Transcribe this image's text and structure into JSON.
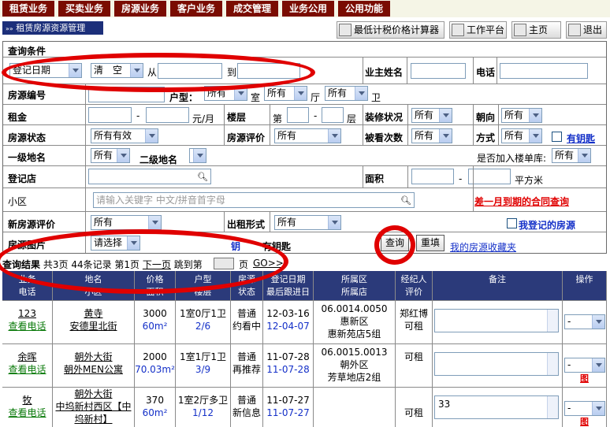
{
  "top_tabs": [
    "租赁业务",
    "买卖业务",
    "房源业务",
    "客户业务",
    "成交管理",
    "业务公用",
    "公用功能"
  ],
  "page_title": "租赁房源资源管理",
  "toolbar": {
    "tax_calc": "最低计税价格计算器",
    "workbench": "工作平台",
    "home": "主页",
    "logout": "退出"
  },
  "form": {
    "section_title": "查询条件",
    "date_type": "登记日期",
    "date_clear": "清　空",
    "from": "从",
    "to": "到",
    "owner_label": "业主姓名",
    "phone_label": "电话",
    "house_no_label": "房源编号",
    "layout_label": "户型：",
    "room_sel": "所有",
    "room_unit": "室",
    "hall_sel": "所有",
    "hall_unit": "厅",
    "bath_sel": "所有",
    "bath_unit": "卫",
    "rent_label": "租金",
    "rent_dash": "-",
    "rent_unit": "元/月",
    "floor_label": "楼层",
    "floor_prefix": "第",
    "floor_dash": "-",
    "floor_unit": "层",
    "decor_label": "装修状况",
    "decor_sel": "所有",
    "orient_label": "朝向",
    "orient_sel": "所有",
    "status_label": "房源状态",
    "status_sel": "所有有效",
    "rating_label": "房源评价",
    "rating_sel": "所有",
    "viewed_label": "被看次数",
    "viewed_sel": "所有",
    "method_label": "方式",
    "method_sel": "所有",
    "has_key": "有钥匙",
    "level1_label": "一级地名",
    "level1_sel": "所有",
    "level2_label": "二级地名",
    "level2_sel": "",
    "bldg_lib_label": "是否加入楼单库:",
    "bldg_lib_sel": "所有",
    "store_label": "登记店",
    "area_label": "面积",
    "area_dash": "-",
    "area_unit": "平方米",
    "community_label": "小区",
    "community_placeholder": "请输入关键字 中文/拼音首字母",
    "expiring_link": "差一月到期的合同查询",
    "new_rating_label": "新房源评价",
    "new_rating_sel": "所有",
    "rent_form_label": "出租形式",
    "rent_form_sel": "所有",
    "my_reg": "我登记的房源",
    "pics_label": "房源图片",
    "pics_sel": "请选择",
    "pics_key_prefix": "钥",
    "pics_key": "有钥匙",
    "search_btn": "查询",
    "reset_btn": "重填",
    "favorites": "我的房源收藏夹"
  },
  "results": {
    "label": "查询结果",
    "pages": "共3页",
    "records": "44条记录",
    "current": "第1页",
    "next": "下一页",
    "jump": "跳到第",
    "page_unit": "页",
    "go": "GO>>"
  },
  "table": {
    "headers": [
      {
        "top": "业务",
        "bottom": "电话"
      },
      {
        "top": "地名",
        "bottom": "小区"
      },
      {
        "top": "价格",
        "bottom": "面积"
      },
      {
        "top": "户型",
        "bottom": "楼层"
      },
      {
        "top": "房源",
        "bottom": "状态"
      },
      {
        "top": "登记日期",
        "bottom": "最后跟进日期"
      },
      {
        "top": "所属区",
        "bottom": "所属店"
      },
      {
        "top": "经纪人",
        "bottom": "评价"
      },
      {
        "top": "备注",
        "bottom": ""
      },
      {
        "top": "操作",
        "bottom": ""
      }
    ],
    "rows": [
      {
        "name": "123",
        "phone": "查看电话",
        "place": "黄寺",
        "community": "安德里北街",
        "price": "3000",
        "area": "60m²",
        "layout": "1室0厅1卫",
        "floor": "2/6",
        "status": "普通",
        "status2": "约看中",
        "reg_date": "12-03-16",
        "follow_date": "12-04-07",
        "district": "06.0014.0050惠新区",
        "store": "惠新苑店5组",
        "agent": "郑红博",
        "rating": "可租",
        "remark": "",
        "op": "-",
        "op_link": ""
      },
      {
        "name": "余晖",
        "phone": "查看电话",
        "place": "朝外大街",
        "community": "朝外MEN公寓",
        "price": "2000",
        "area": "70.03m²",
        "layout": "1室1厅1卫",
        "floor": "3/9",
        "status": "普通",
        "status2": "再推荐",
        "reg_date": "11-07-28",
        "follow_date": "11-07-28",
        "district": "06.0015.0013朝外区",
        "store": "芳草地店2组",
        "agent": "",
        "rating": "可租",
        "remark": "",
        "op": "-",
        "op_link": "图"
      },
      {
        "name": "牧",
        "phone": "查看电话",
        "place": "朝外大街",
        "community": "中坞新村西区【中坞新村】",
        "price": "370",
        "area": "60m²",
        "layout": "1室2厅多卫",
        "floor": "1/12",
        "status": "普通",
        "status2": "新信息",
        "reg_date": "11-07-27",
        "follow_date": "11-07-27",
        "district": "",
        "store": "",
        "agent": "",
        "rating": "可租",
        "remark": "33",
        "op": "-",
        "op_link": "图"
      }
    ]
  },
  "colors": {
    "nav_tab": "#7a0c02",
    "header_bg": "#2b3a7a",
    "annotation": "#e00000",
    "link": "#1430c8"
  }
}
